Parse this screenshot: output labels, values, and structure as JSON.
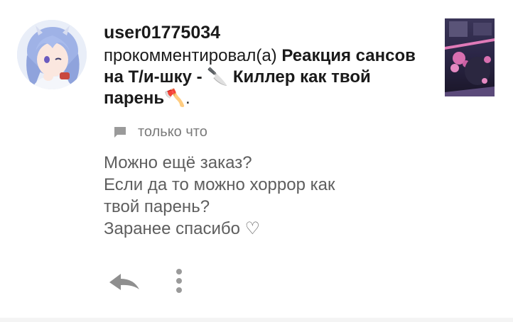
{
  "notification": {
    "username": "user01775034",
    "action_text": "прокомментировал(а)",
    "post_title": "Реакция сансов на Т/и-шку - 🔪 Киллер как твой парень🪓",
    "post_title_suffix": ".",
    "timestamp": "только что"
  },
  "comment": {
    "lines": [
      "Можно ещё заказ?",
      "Если да то можно хоррор как",
      "твой парень?",
      "Заранее спасибо ♡"
    ]
  },
  "icons": {
    "comment": "comment-icon",
    "reply": "reply-icon",
    "more": "more-vertical-icon"
  },
  "colors": {
    "text_primary": "#1a1a1a",
    "text_secondary": "#5e5e5e",
    "meta_gray": "#7a7a7a",
    "icon_gray": "#9a9a9a"
  }
}
